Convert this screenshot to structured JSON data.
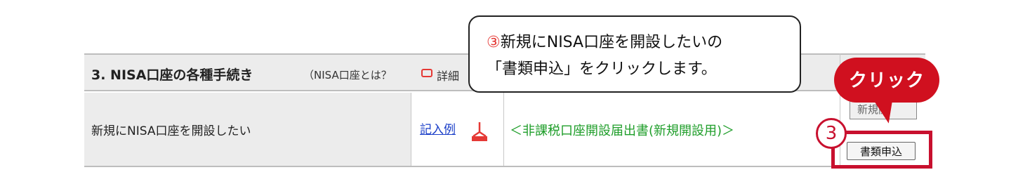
{
  "section": {
    "title": "3. NISA口座の各種手続き",
    "subtitle": "（NISA口座とは？",
    "detail_label": "詳細"
  },
  "row": {
    "procedure_label": "新規にNISA口座を開設したい",
    "example_link": "記入例",
    "form_link": "＜非課税口座開設届出書(新規開設用)＞",
    "apply_button": "書類申込",
    "ghost_button": "新規開"
  },
  "callout": {
    "step_number": "③",
    "line1": "新規にNISA口座を開設したいの",
    "line2": "「書類申込」をクリックします。"
  },
  "annotation": {
    "step": "3",
    "click_label": "クリック"
  },
  "colors": {
    "accent_red": "#d0101f",
    "link_blue": "#1a3ec8",
    "link_green": "#1f9e2a"
  }
}
